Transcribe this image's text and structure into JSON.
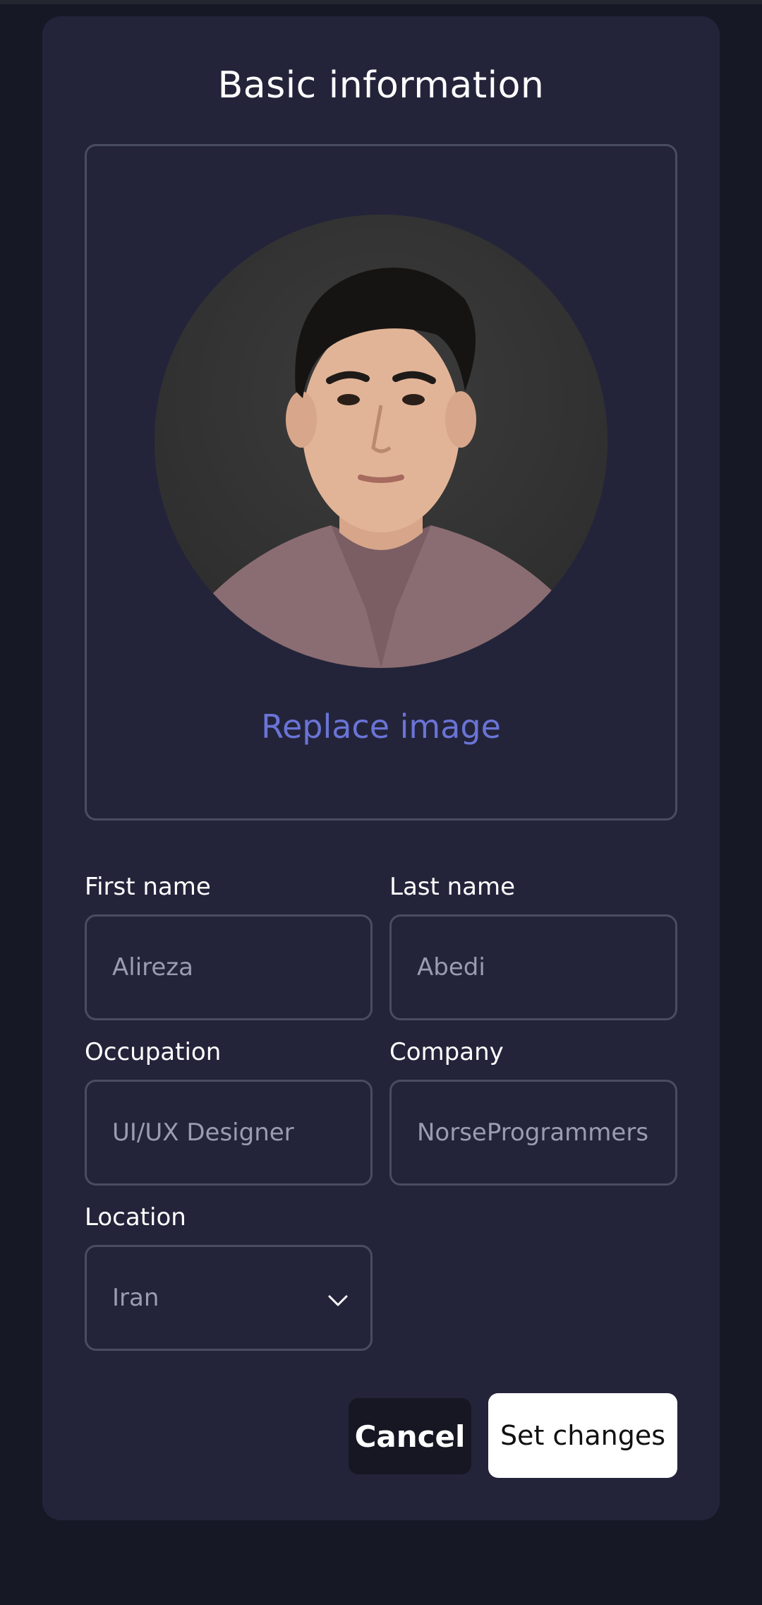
{
  "form": {
    "title": "Basic information",
    "replace_image_label": "Replace image",
    "fields": {
      "first_name": {
        "label": "First name",
        "value": "Alireza"
      },
      "last_name": {
        "label": "Last name",
        "value": "Abedi"
      },
      "occupation": {
        "label": "Occupation",
        "value": "UI/UX Designer"
      },
      "company": {
        "label": "Company",
        "value": "NorseProgrammers"
      },
      "location": {
        "label": "Location",
        "value": "Iran"
      }
    },
    "buttons": {
      "cancel": "Cancel",
      "submit": "Set changes"
    }
  },
  "icons": {
    "location_dropdown": "chevron-down-icon"
  },
  "colors": {
    "page_bg": "#161826",
    "card_bg": "#23243a",
    "accent": "#6a74d6",
    "border": "#4a4c62"
  }
}
